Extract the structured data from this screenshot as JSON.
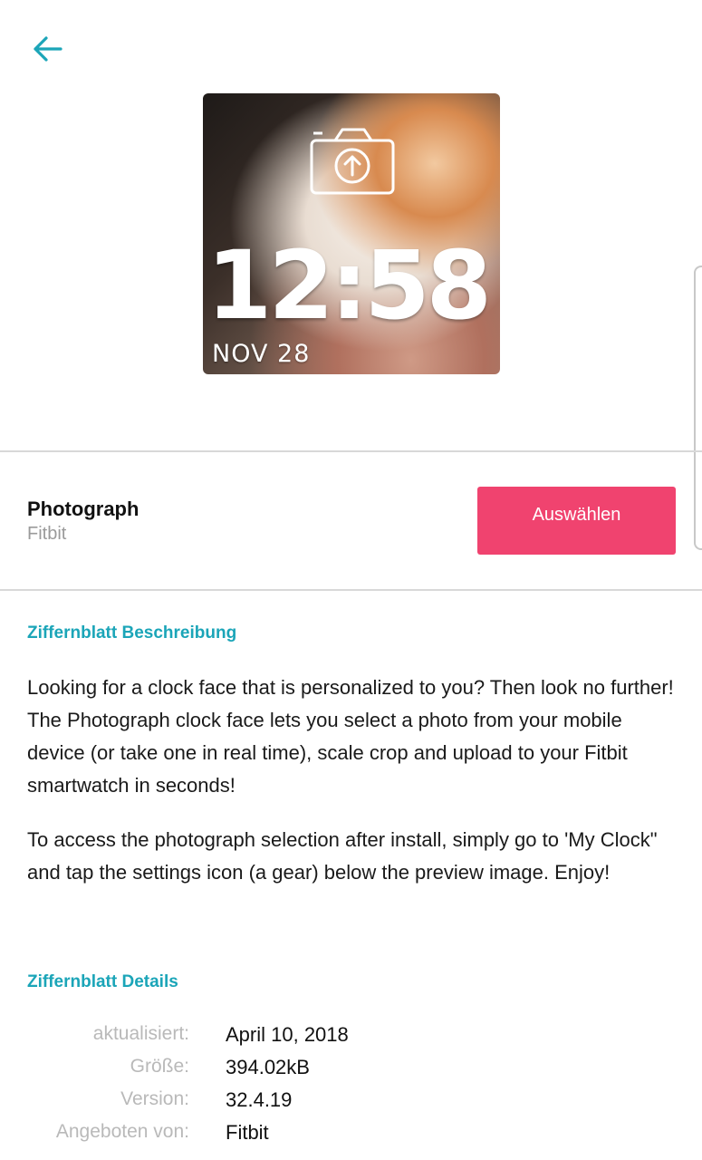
{
  "header": {
    "back_icon": "arrow-left-icon",
    "accent": "#1ba5b8"
  },
  "preview": {
    "time": "12:58",
    "date": "NOV 28",
    "upload_icon": "camera-upload-icon"
  },
  "app": {
    "name": "Photograph",
    "vendor": "Fitbit",
    "select_label": "Auswählen",
    "select_color": "#f0436f"
  },
  "description": {
    "heading": "Ziffernblatt Beschreibung",
    "paragraph1": "Looking for a clock face that is personalized to you? Then look no further! The Photograph clock face lets you select a photo from your mobile device (or take one in real time), scale crop and upload to your Fitbit smartwatch in seconds!",
    "paragraph2": "To access the photograph selection after install, simply go to 'My Clock\" and tap the settings icon (a gear) below the preview image. Enjoy!"
  },
  "details": {
    "heading": "Ziffernblatt Details",
    "rows": [
      {
        "label": "aktualisiert:",
        "value": "April 10, 2018"
      },
      {
        "label": "Größe:",
        "value": "394.02kB"
      },
      {
        "label": "Version:",
        "value": "32.4.19"
      },
      {
        "label": "Angeboten von:",
        "value": "Fitbit"
      }
    ]
  }
}
